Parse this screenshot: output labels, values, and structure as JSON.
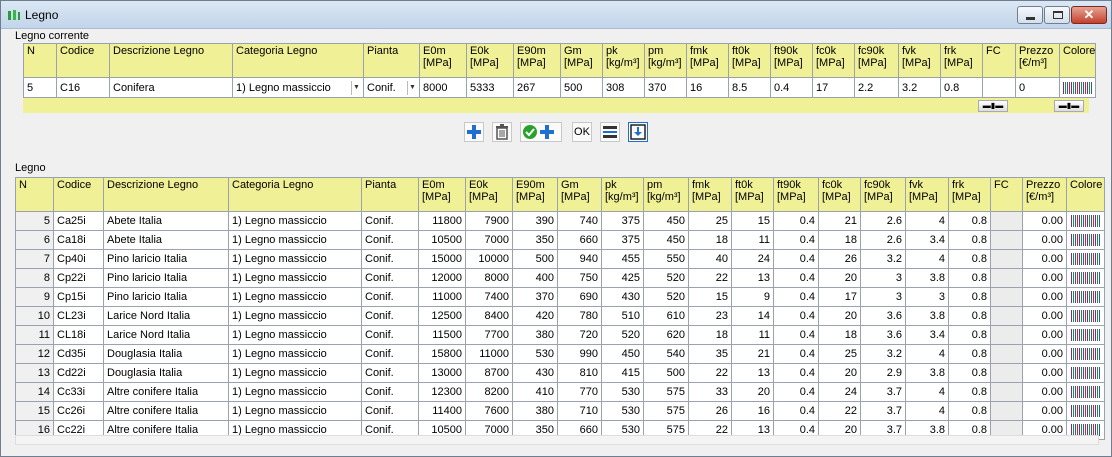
{
  "window": {
    "title": "Legno"
  },
  "current": {
    "group_label": "Legno corrente",
    "headers": [
      "N",
      "Codice",
      "Descrizione Legno",
      "Categoria Legno",
      "Pianta",
      "E0m\n[MPa]",
      "E0k\n[MPa]",
      "E90m\n[MPa]",
      "Gm\n[MPa]",
      "pk\n[kg/m³]",
      "pm\n[kg/m³]",
      "fmk\n[MPa]",
      "ft0k\n[MPa]",
      "ft90k\n[MPa]",
      "fc0k\n[MPa]",
      "fc90k\n[MPa]",
      "fvk\n[MPa]",
      "frk\n[MPa]",
      "FC",
      "Prezzo\n[€/m³]",
      "Colore"
    ],
    "values": [
      "5",
      "C16",
      "Conifera",
      "1) Legno massiccio",
      "Conif.",
      "8000",
      "5333",
      "267",
      "500",
      "308",
      "370",
      "16",
      "8.5",
      "0.4",
      "17",
      "2.2",
      "3.2",
      "0.8",
      "",
      "0",
      ""
    ]
  },
  "toolbar": {
    "ok_label": "OK"
  },
  "list": {
    "group_label": "Legno",
    "headers": [
      "N",
      "Codice",
      "Descrizione Legno",
      "Categoria Legno",
      "Pianta",
      "E0m\n[MPa]",
      "E0k\n[MPa]",
      "E90m\n[MPa]",
      "Gm\n[MPa]",
      "pk\n[kg/m³]",
      "pm\n[kg/m³]",
      "fmk\n[MPa]",
      "ft0k\n[MPa]",
      "ft90k\n[MPa]",
      "fc0k\n[MPa]",
      "fc90k\n[MPa]",
      "fvk\n[MPa]",
      "frk\n[MPa]",
      "FC",
      "Prezzo\n[€/m³]",
      "Colore"
    ],
    "rows": [
      [
        "5",
        "Ca25i",
        "Abete Italia",
        "1) Legno massiccio",
        "Conif.",
        "11800",
        "7900",
        "390",
        "740",
        "375",
        "450",
        "25",
        "15",
        "0.4",
        "21",
        "2.6",
        "4",
        "0.8",
        "",
        "0.00",
        ""
      ],
      [
        "6",
        "Ca18i",
        "Abete Italia",
        "1) Legno massiccio",
        "Conif.",
        "10500",
        "7000",
        "350",
        "660",
        "375",
        "450",
        "18",
        "11",
        "0.4",
        "18",
        "2.6",
        "3.4",
        "0.8",
        "",
        "0.00",
        ""
      ],
      [
        "7",
        "Cp40i",
        "Pino laricio Italia",
        "1) Legno massiccio",
        "Conif.",
        "15000",
        "10000",
        "500",
        "940",
        "455",
        "550",
        "40",
        "24",
        "0.4",
        "26",
        "3.2",
        "4",
        "0.8",
        "",
        "0.00",
        ""
      ],
      [
        "8",
        "Cp22i",
        "Pino laricio Italia",
        "1) Legno massiccio",
        "Conif.",
        "12000",
        "8000",
        "400",
        "750",
        "425",
        "520",
        "22",
        "13",
        "0.4",
        "20",
        "3",
        "3.8",
        "0.8",
        "",
        "0.00",
        ""
      ],
      [
        "9",
        "Cp15i",
        "Pino laricio Italia",
        "1) Legno massiccio",
        "Conif.",
        "11000",
        "7400",
        "370",
        "690",
        "430",
        "520",
        "15",
        "9",
        "0.4",
        "17",
        "3",
        "3",
        "0.8",
        "",
        "0.00",
        ""
      ],
      [
        "10",
        "CL23i",
        "Larice Nord Italia",
        "1) Legno massiccio",
        "Conif.",
        "12500",
        "8400",
        "420",
        "780",
        "510",
        "610",
        "23",
        "14",
        "0.4",
        "20",
        "3.6",
        "3.8",
        "0.8",
        "",
        "0.00",
        ""
      ],
      [
        "11",
        "CL18i",
        "Larice Nord Italia",
        "1) Legno massiccio",
        "Conif.",
        "11500",
        "7700",
        "380",
        "720",
        "520",
        "620",
        "18",
        "11",
        "0.4",
        "18",
        "3.6",
        "3.4",
        "0.8",
        "",
        "0.00",
        ""
      ],
      [
        "12",
        "Cd35i",
        "Douglasia Italia",
        "1) Legno massiccio",
        "Conif.",
        "15800",
        "11000",
        "530",
        "990",
        "450",
        "540",
        "35",
        "21",
        "0.4",
        "25",
        "3.2",
        "4",
        "0.8",
        "",
        "0.00",
        ""
      ],
      [
        "13",
        "Cd22i",
        "Douglasia Italia",
        "1) Legno massiccio",
        "Conif.",
        "13000",
        "8700",
        "430",
        "810",
        "415",
        "500",
        "22",
        "13",
        "0.4",
        "20",
        "2.9",
        "3.8",
        "0.8",
        "",
        "0.00",
        ""
      ],
      [
        "14",
        "Cc33i",
        "Altre conifere Italia",
        "1) Legno massiccio",
        "Conif.",
        "12300",
        "8200",
        "410",
        "770",
        "530",
        "575",
        "33",
        "20",
        "0.4",
        "24",
        "3.7",
        "4",
        "0.8",
        "",
        "0.00",
        ""
      ],
      [
        "15",
        "Cc26i",
        "Altre conifere Italia",
        "1) Legno massiccio",
        "Conif.",
        "11400",
        "7600",
        "380",
        "710",
        "530",
        "575",
        "26",
        "16",
        "0.4",
        "22",
        "3.7",
        "4",
        "0.8",
        "",
        "0.00",
        ""
      ],
      [
        "16",
        "Cc22i",
        "Altre conifere Italia",
        "1) Legno massiccio",
        "Conif.",
        "10500",
        "7000",
        "350",
        "660",
        "530",
        "575",
        "22",
        "13",
        "0.4",
        "20",
        "3.7",
        "3.8",
        "0.8",
        "",
        "0.00",
        ""
      ]
    ]
  },
  "colors": {
    "header_bg": "#f0f096",
    "add_blue": "#1e6fd0",
    "confirm_green": "#2aa12a"
  }
}
